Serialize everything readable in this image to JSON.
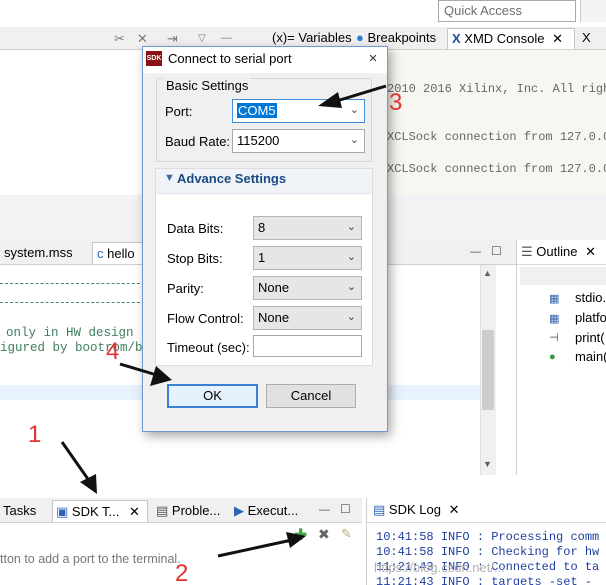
{
  "ide": {
    "quick_access_placeholder": "Quick Access",
    "top_tabs": [
      "(x)= Variables",
      "Breakpoints",
      "XMD Console",
      "X"
    ],
    "console_lines": [
      "2010 2016 Xilinx, Inc. All rights",
      "XCLSock connection from 127.0.0.1",
      "XCLSock connection from 127.0.0.1"
    ],
    "editor_tabs": [
      "system.mss",
      "hello"
    ],
    "code_lines": [
      "only in HW design",
      "igured by bootrom/bsp"
    ],
    "outline": {
      "title": "Outline",
      "items": [
        "stdio.",
        "platfo",
        "print(",
        "main("
      ]
    },
    "bottom_tabs": [
      "Tasks",
      "SDK T...",
      "Proble...",
      "Execut..."
    ],
    "hint_text": "tton to add a port to the terminal.",
    "sdk_log": {
      "title": "SDK Log",
      "lines": [
        {
          "time": "10:41:58",
          "level": "INFO",
          "msg": ": Processing comm"
        },
        {
          "time": "10:41:58",
          "level": "INFO",
          "msg": ": Checking for hw"
        },
        {
          "time": "11:21:43",
          "level": "INFO",
          "msg": ": Connected to ta"
        },
        {
          "time": "11:21:43",
          "level": "INFO",
          "msg": ": targets -set -"
        }
      ]
    },
    "watermark": "https://blog.csdn.net/..."
  },
  "dialog": {
    "app_icon": "SDK",
    "title": "Connect to serial port",
    "close_glyph": "×",
    "basic_settings_label": "Basic Settings",
    "port": {
      "label": "Port:",
      "value": "COM5"
    },
    "baud_rate": {
      "label": "Baud Rate:",
      "value": "115200"
    },
    "advance_settings_label": "Advance Settings",
    "data_bits": {
      "label": "Data Bits:",
      "value": "8"
    },
    "stop_bits": {
      "label": "Stop Bits:",
      "value": "1"
    },
    "parity": {
      "label": "Parity:",
      "value": "None"
    },
    "flow_control": {
      "label": "Flow Control:",
      "value": "None"
    },
    "timeout": {
      "label": "Timeout (sec):",
      "value": ""
    },
    "ok_label": "OK",
    "cancel_label": "Cancel"
  },
  "annotations": [
    "1",
    "2",
    "3",
    "4"
  ],
  "colors": {
    "annotation": "#e33030",
    "accent": "#0078d7",
    "link_blue": "#1c4b82"
  }
}
